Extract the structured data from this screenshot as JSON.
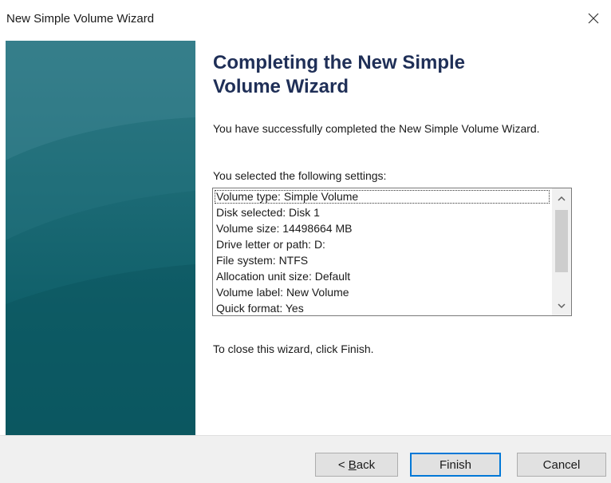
{
  "window": {
    "title": "New Simple Volume Wizard",
    "close_icon": "close-icon"
  },
  "content": {
    "heading": "Completing the New Simple Volume Wizard",
    "intro": "You have successfully completed the New Simple Volume Wizard.",
    "settings_label": "You selected the following settings:",
    "settings": [
      "Volume type: Simple Volume",
      "Disk selected: Disk 1",
      "Volume size: 14498664 MB",
      "Drive letter or path: D:",
      "File system: NTFS",
      "Allocation unit size: Default",
      "Volume label: New Volume",
      "Quick format: Yes"
    ],
    "close_hint": "To close this wizard, click Finish."
  },
  "buttons": {
    "back_prefix": "< ",
    "back_mnemonic": "B",
    "back_rest": "ack",
    "finish": "Finish",
    "cancel": "Cancel"
  },
  "colors": {
    "accent": "#0078d7",
    "side_panel": "#1d6b76",
    "heading": "#1f2f57"
  }
}
